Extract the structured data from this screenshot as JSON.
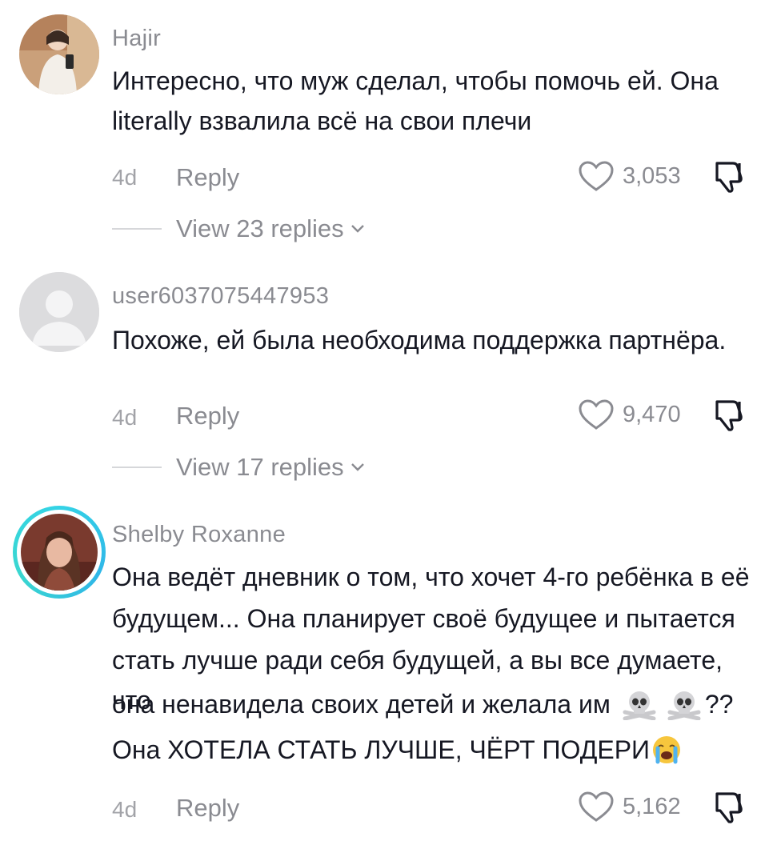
{
  "comments": [
    {
      "username": "Hajir",
      "text_lines": [
        "Интересно, что муж сделал, чтобы помочь ей. Она",
        "literally взвалила всё на свои плечи"
      ],
      "time": "4d",
      "reply_label": "Reply",
      "likes": "3,053",
      "view_replies": "View 23 replies"
    },
    {
      "username": "user6037075447953",
      "text_lines": [
        "Похоже, ей была необходима поддержка партнёра."
      ],
      "time": "4d",
      "reply_label": "Reply",
      "likes": "9,470",
      "view_replies": "View 17 replies"
    },
    {
      "username": "Shelby Roxanne",
      "text_lines": [
        "Она ведёт дневник о том, что хочет 4-го ребёнка в её",
        "будущем... Она планирует своё будущее и пытается",
        "стать лучше ради себя будущей, а вы все думаете, что",
        "она ненавидела своих детей и желала им",
        "??",
        "Она ХОТЕЛА СТАТЬ ЛУЧШЕ, ЧЁРТ ПОДЕРИ"
      ],
      "time": "4d",
      "reply_label": "Reply",
      "likes": "5,162"
    }
  ],
  "icons": {
    "like": "heart-outline-icon",
    "dislike": "thumbs-down-icon",
    "expand": "chevron-down-icon",
    "emoji_skull": "skull-crossbones-emoji",
    "emoji_crying": "loudly-crying-face-emoji"
  },
  "colors": {
    "text": "#161823",
    "secondary": "#8a8b91",
    "muted": "#a2a3a8",
    "story_ring": "#34d3e6"
  }
}
